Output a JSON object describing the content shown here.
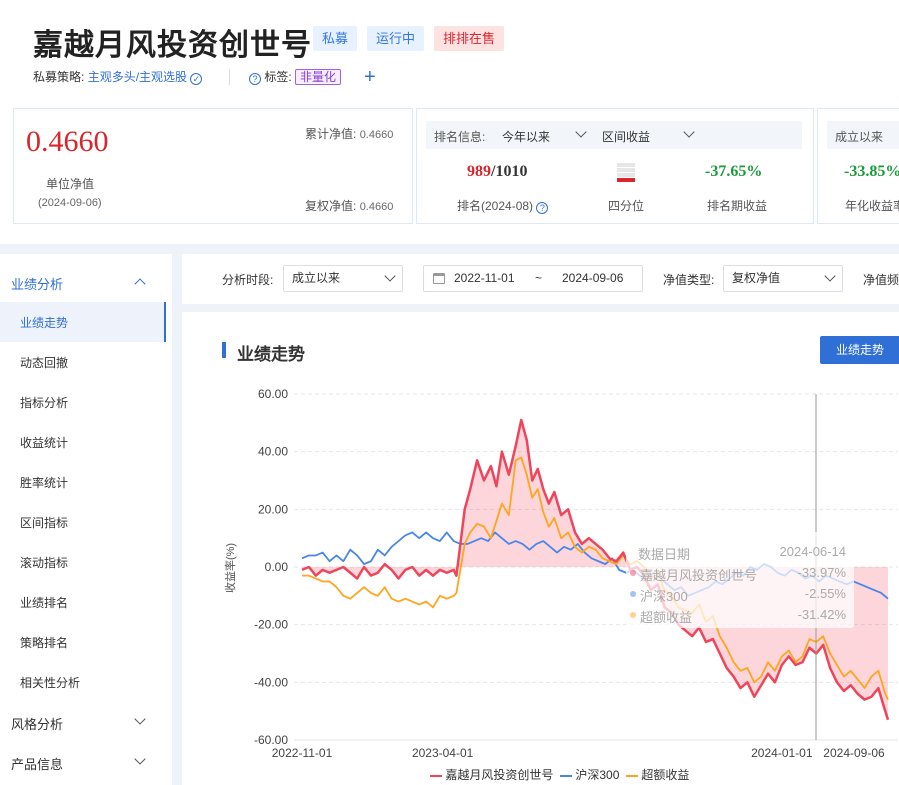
{
  "header": {
    "title": "嘉越月风投资创世号",
    "tags": [
      "私募",
      "运行中",
      "排排在售"
    ],
    "strategy_label": "私募策略:",
    "strategy_value": "主观多头/主观选股",
    "tag_label": "标签:",
    "tag_value": "非量化",
    "add_icon": "plus-icon"
  },
  "nav_card": {
    "unit_nav": "0.4660",
    "unit_nav_label": "单位净值",
    "unit_nav_date": "(2024-09-06)",
    "cum_nav_label": "累计净值:",
    "cum_nav": "0.4660",
    "adj_nav_label": "复权净值:",
    "adj_nav": "0.4660"
  },
  "rank_card": {
    "label": "排名信息:",
    "period": "今年以来",
    "metric": "区间收益",
    "rank": "989",
    "rank_total": "/1010",
    "rank_label": "排名(2024-08)",
    "quartile_label": "四分位",
    "period_return": "-37.65%",
    "period_return_label": "排名期收益"
  },
  "since_card": {
    "label": "成立以来",
    "annual_return": "-33.85%",
    "annual_return_label": "年化收益率"
  },
  "sidebar": {
    "sections": [
      {
        "label": "业绩分析",
        "expanded": true
      },
      {
        "label": "风格分析",
        "expanded": false
      },
      {
        "label": "产品信息",
        "expanded": false
      }
    ],
    "items": [
      "业绩走势",
      "动态回撤",
      "指标分析",
      "收益统计",
      "胜率统计",
      "区间指标",
      "滚动指标",
      "业绩排名",
      "策略排名",
      "相关性分析"
    ],
    "active_item": "业绩走势"
  },
  "filters": {
    "period_label": "分析时段:",
    "period_value": "成立以来",
    "date_start": "2022-11-01",
    "date_sep": "~",
    "date_end": "2024-09-06",
    "nav_type_label": "净值类型:",
    "nav_type_value": "复权净值",
    "freq_label": "净值频"
  },
  "panel": {
    "title": "业绩走势",
    "button": "业绩走势"
  },
  "tooltip": {
    "date_label": "数据日期",
    "date_value": "2024-06-14",
    "rows": [
      {
        "name": "嘉越月风投资创世号",
        "value": "-33.97%"
      },
      {
        "name": "沪深300",
        "value": "-2.55%"
      },
      {
        "name": "超额收益",
        "value": "-31.42%"
      }
    ]
  },
  "colors": {
    "fund": "#f0445a",
    "index": "#4a86e8",
    "excess": "#ffa51f",
    "accent": "#2f6fd6",
    "red": "#d8262c",
    "green": "#1a9b3a"
  },
  "chart_data": {
    "type": "line",
    "ylabel": "收益率(%)",
    "ylim": [
      -60,
      60
    ],
    "yticks": [
      "60.00",
      "40.00",
      "20.00",
      "0.00",
      "-20.00",
      "-40.00",
      "-60.00"
    ],
    "xticks": [
      "2022-11-01",
      "2023-04-01",
      "2024-01-01",
      "2024-09-06"
    ],
    "series": [
      {
        "name": "嘉越月风投资创世号",
        "color": "#f0445a",
        "points": [
          [
            0,
            -1
          ],
          [
            5,
            0
          ],
          [
            10,
            -3
          ],
          [
            15,
            -1
          ],
          [
            20,
            -2
          ],
          [
            25,
            -1
          ],
          [
            30,
            0
          ],
          [
            35,
            -2
          ],
          [
            40,
            -4
          ],
          [
            45,
            0
          ],
          [
            50,
            -3
          ],
          [
            55,
            -2
          ],
          [
            60,
            1
          ],
          [
            65,
            -1
          ],
          [
            70,
            -4
          ],
          [
            75,
            -1
          ],
          [
            80,
            0
          ],
          [
            85,
            -3
          ],
          [
            90,
            -1
          ],
          [
            95,
            -3
          ],
          [
            100,
            -1
          ],
          [
            105,
            -2
          ],
          [
            110,
            -1
          ],
          [
            112,
            -3
          ],
          [
            118,
            20
          ],
          [
            122,
            27
          ],
          [
            127,
            37
          ],
          [
            132,
            30
          ],
          [
            137,
            35
          ],
          [
            141,
            28
          ],
          [
            145,
            40
          ],
          [
            150,
            32
          ],
          [
            155,
            42
          ],
          [
            159,
            51
          ],
          [
            163,
            44
          ],
          [
            167,
            30
          ],
          [
            171,
            34
          ],
          [
            175,
            27
          ],
          [
            179,
            22
          ],
          [
            183,
            26
          ],
          [
            188,
            18
          ],
          [
            193,
            20
          ],
          [
            198,
            12
          ],
          [
            203,
            8
          ],
          [
            208,
            10
          ],
          [
            213,
            8
          ],
          [
            218,
            6
          ],
          [
            223,
            3
          ],
          [
            228,
            2
          ],
          [
            233,
            5
          ],
          [
            238,
            -1
          ],
          [
            243,
            0
          ],
          [
            248,
            -3
          ],
          [
            253,
            -8
          ],
          [
            258,
            -6
          ],
          [
            263,
            -14
          ],
          [
            268,
            -16
          ],
          [
            273,
            -20
          ],
          [
            278,
            -22
          ],
          [
            283,
            -24
          ],
          [
            288,
            -21
          ],
          [
            293,
            -26
          ],
          [
            298,
            -25
          ],
          [
            303,
            -30
          ],
          [
            308,
            -35
          ],
          [
            313,
            -38
          ],
          [
            318,
            -42
          ],
          [
            323,
            -40
          ],
          [
            328,
            -45
          ],
          [
            333,
            -41
          ],
          [
            338,
            -37
          ],
          [
            343,
            -40
          ],
          [
            348,
            -34
          ],
          [
            353,
            -31
          ],
          [
            358,
            -34
          ],
          [
            363,
            -33
          ],
          [
            368,
            -28
          ],
          [
            373,
            -30
          ],
          [
            378,
            -27
          ],
          [
            383,
            -35
          ],
          [
            388,
            -40
          ],
          [
            393,
            -43
          ],
          [
            398,
            -41
          ],
          [
            403,
            -44
          ],
          [
            408,
            -46
          ],
          [
            413,
            -45
          ],
          [
            418,
            -42
          ],
          [
            423,
            -50
          ],
          [
            425,
            -53
          ]
        ]
      },
      {
        "name": "沪深300",
        "color": "#4a86e8",
        "points": [
          [
            0,
            3
          ],
          [
            5,
            4
          ],
          [
            10,
            4
          ],
          [
            15,
            5
          ],
          [
            20,
            2
          ],
          [
            25,
            4
          ],
          [
            30,
            2
          ],
          [
            35,
            6
          ],
          [
            40,
            4
          ],
          [
            45,
            1
          ],
          [
            50,
            2
          ],
          [
            55,
            6
          ],
          [
            60,
            4
          ],
          [
            65,
            7
          ],
          [
            70,
            9
          ],
          [
            75,
            11
          ],
          [
            80,
            12
          ],
          [
            85,
            10
          ],
          [
            90,
            12
          ],
          [
            95,
            10
          ],
          [
            100,
            9
          ],
          [
            105,
            12
          ],
          [
            110,
            9
          ],
          [
            115,
            8
          ],
          [
            120,
            8
          ],
          [
            125,
            9
          ],
          [
            130,
            10
          ],
          [
            135,
            9
          ],
          [
            140,
            12
          ],
          [
            145,
            10
          ],
          [
            150,
            8
          ],
          [
            155,
            9
          ],
          [
            160,
            8
          ],
          [
            165,
            6
          ],
          [
            170,
            8
          ],
          [
            175,
            9
          ],
          [
            180,
            7
          ],
          [
            185,
            5
          ],
          [
            190,
            7
          ],
          [
            195,
            6
          ],
          [
            200,
            8
          ],
          [
            205,
            5
          ],
          [
            210,
            3
          ],
          [
            215,
            2
          ],
          [
            220,
            1
          ],
          [
            225,
            3
          ],
          [
            230,
            -1
          ],
          [
            235,
            -2
          ],
          [
            240,
            -1
          ],
          [
            245,
            -3
          ],
          [
            250,
            -4
          ],
          [
            255,
            -2
          ],
          [
            260,
            -4
          ],
          [
            265,
            -6
          ],
          [
            270,
            -8
          ],
          [
            275,
            -7
          ],
          [
            280,
            -10
          ],
          [
            285,
            -9
          ],
          [
            290,
            -8
          ],
          [
            295,
            -7
          ],
          [
            300,
            -5
          ],
          [
            305,
            -6
          ],
          [
            310,
            -4
          ],
          [
            315,
            -2
          ],
          [
            320,
            -3
          ],
          [
            325,
            0
          ],
          [
            330,
            -1
          ],
          [
            335,
            1
          ],
          [
            340,
            0
          ],
          [
            345,
            -2
          ],
          [
            350,
            -3
          ],
          [
            355,
            -1
          ],
          [
            360,
            -2
          ],
          [
            365,
            -4
          ],
          [
            370,
            -3
          ],
          [
            375,
            -5
          ],
          [
            380,
            -3
          ],
          [
            385,
            -4
          ],
          [
            390,
            -5
          ],
          [
            395,
            -6
          ],
          [
            400,
            -5
          ],
          [
            405,
            -6
          ],
          [
            410,
            -7
          ],
          [
            415,
            -8
          ],
          [
            420,
            -9
          ],
          [
            425,
            -11
          ]
        ]
      },
      {
        "name": "超额收益",
        "color": "#ffa51f",
        "points": [
          [
            0,
            -3
          ],
          [
            5,
            -3
          ],
          [
            10,
            -4
          ],
          [
            15,
            -5
          ],
          [
            20,
            -5
          ],
          [
            25,
            -7
          ],
          [
            30,
            -10
          ],
          [
            35,
            -11
          ],
          [
            40,
            -9
          ],
          [
            45,
            -7
          ],
          [
            50,
            -9
          ],
          [
            55,
            -10
          ],
          [
            60,
            -7
          ],
          [
            65,
            -11
          ],
          [
            70,
            -12
          ],
          [
            75,
            -11
          ],
          [
            80,
            -12
          ],
          [
            85,
            -13
          ],
          [
            90,
            -12
          ],
          [
            95,
            -14
          ],
          [
            100,
            -10
          ],
          [
            105,
            -11
          ],
          [
            110,
            -10
          ],
          [
            112,
            -9
          ],
          [
            118,
            8
          ],
          [
            122,
            12
          ],
          [
            127,
            15
          ],
          [
            132,
            14
          ],
          [
            137,
            10
          ],
          [
            141,
            16
          ],
          [
            145,
            22
          ],
          [
            150,
            18
          ],
          [
            155,
            37
          ],
          [
            159,
            38
          ],
          [
            163,
            32
          ],
          [
            167,
            24
          ],
          [
            171,
            27
          ],
          [
            175,
            19
          ],
          [
            179,
            14
          ],
          [
            183,
            17
          ],
          [
            188,
            10
          ],
          [
            193,
            12
          ],
          [
            198,
            7
          ],
          [
            203,
            5
          ],
          [
            208,
            7
          ],
          [
            213,
            6
          ],
          [
            218,
            3
          ],
          [
            223,
            2
          ],
          [
            228,
            1
          ],
          [
            233,
            4
          ],
          [
            238,
            1
          ],
          [
            243,
            2
          ],
          [
            248,
            0
          ],
          [
            253,
            -4
          ],
          [
            258,
            -2
          ],
          [
            263,
            -8
          ],
          [
            268,
            -10
          ],
          [
            273,
            -14
          ],
          [
            278,
            -15
          ],
          [
            283,
            -16
          ],
          [
            288,
            -13
          ],
          [
            293,
            -19
          ],
          [
            298,
            -17
          ],
          [
            303,
            -24
          ],
          [
            308,
            -28
          ],
          [
            313,
            -33
          ],
          [
            318,
            -36
          ],
          [
            323,
            -35
          ],
          [
            328,
            -40
          ],
          [
            333,
            -38
          ],
          [
            338,
            -33
          ],
          [
            343,
            -36
          ],
          [
            348,
            -31
          ],
          [
            353,
            -29
          ],
          [
            358,
            -33
          ],
          [
            363,
            -31
          ],
          [
            368,
            -25
          ],
          [
            373,
            -26
          ],
          [
            378,
            -24
          ],
          [
            383,
            -30
          ],
          [
            388,
            -34
          ],
          [
            393,
            -38
          ],
          [
            398,
            -36
          ],
          [
            403,
            -39
          ],
          [
            408,
            -42
          ],
          [
            413,
            -38
          ],
          [
            418,
            -36
          ],
          [
            423,
            -44
          ],
          [
            425,
            -46
          ]
        ]
      }
    ]
  },
  "legend": [
    "嘉越月风投资创世号",
    "沪深300",
    "超额收益"
  ]
}
